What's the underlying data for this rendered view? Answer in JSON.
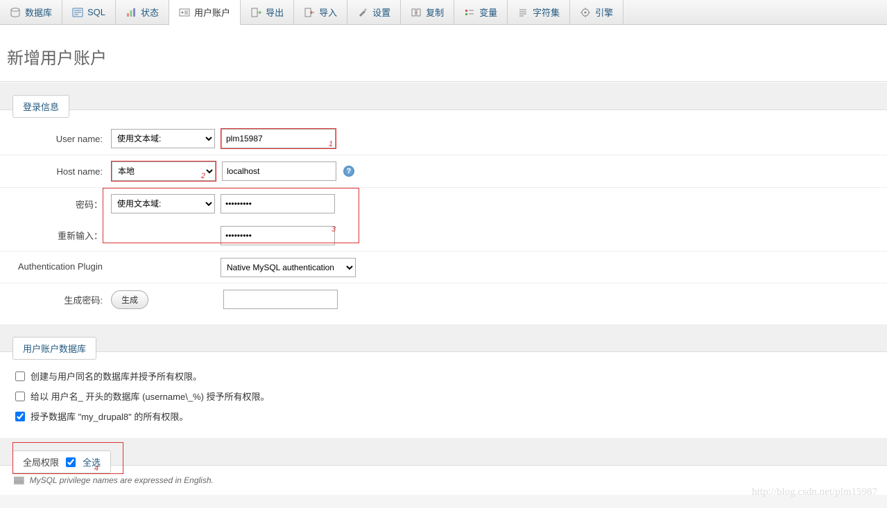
{
  "tabs": [
    {
      "label": "数据库",
      "icon": "db"
    },
    {
      "label": "SQL",
      "icon": "sql"
    },
    {
      "label": "状态",
      "icon": "status"
    },
    {
      "label": "用户账户",
      "icon": "user",
      "active": true
    },
    {
      "label": "导出",
      "icon": "export"
    },
    {
      "label": "导入",
      "icon": "import"
    },
    {
      "label": "设置",
      "icon": "settings"
    },
    {
      "label": "复制",
      "icon": "replication"
    },
    {
      "label": "变量",
      "icon": "vars"
    },
    {
      "label": "字符集",
      "icon": "charset"
    },
    {
      "label": "引擎",
      "icon": "engine"
    }
  ],
  "page_title": "新增用户账户",
  "login_legend": "登录信息",
  "labels": {
    "username": "User name:",
    "hostname": "Host name:",
    "password": "密码：",
    "retype": "重新输入：",
    "authplugin": "Authentication Plugin",
    "genpass": "生成密码:"
  },
  "selects": {
    "username_mode": "使用文本域:",
    "host_mode": "本地",
    "password_mode": "使用文本域:",
    "authplugin": "Native MySQL authentication"
  },
  "inputs": {
    "username": "plm15987",
    "hostname": "localhost",
    "password": "•••••••••",
    "retype": "•••••••••",
    "genpass": ""
  },
  "buttons": {
    "generate": "生成"
  },
  "db_legend": "用户账户数据库",
  "db_checks": [
    {
      "label": "创建与用户同名的数据库并授予所有权限。",
      "checked": false
    },
    {
      "label": "给以 用户名_ 开头的数据库 (username\\_%) 授予所有权限。",
      "checked": false
    },
    {
      "label": "授予数据库 \"my_drupal8\" 的所有权限。",
      "checked": true
    }
  ],
  "global_priv_label": "全局权限",
  "global_select_all": "全选",
  "note_text": "MySQL privilege names are expressed in English.",
  "annotations": {
    "a1": "1",
    "a2": "2",
    "a3": "3",
    "a4": "4"
  },
  "watermark": "http://blog.csdn.net/plm15987"
}
